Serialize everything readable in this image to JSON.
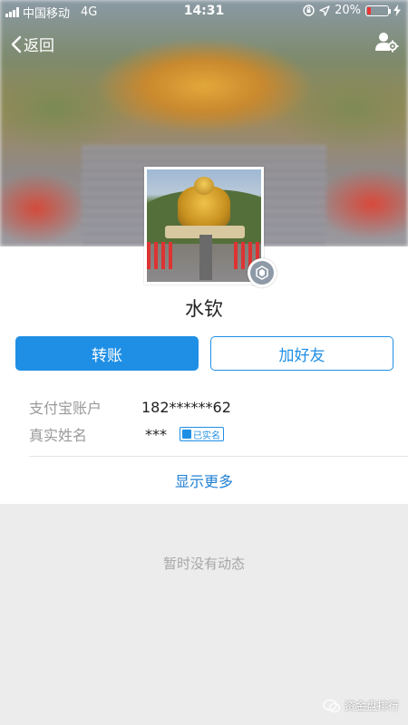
{
  "status_bar": {
    "carrier": "中国移动",
    "network": "4G",
    "time": "14:31",
    "battery_percent": "20%",
    "battery_level": 0.2,
    "icons": [
      "signal-icon",
      "lock-rotation-icon",
      "location-icon",
      "battery-icon",
      "charging-icon"
    ]
  },
  "nav": {
    "back_label": "返回",
    "settings_icon": "user-settings-icon"
  },
  "profile": {
    "name": "水钦",
    "verified_icon": "verified-badge-icon"
  },
  "actions": {
    "transfer_label": "转账",
    "add_friend_label": "加好友"
  },
  "info": {
    "account_label": "支付宝账户",
    "account_value": "182******62",
    "realname_label": "真实姓名",
    "realname_value": "***",
    "realname_badge": "已实名"
  },
  "more_label": "显示更多",
  "empty_state": "暂时没有动态",
  "watermark": "资金盘排行",
  "colors": {
    "accent": "#1f8fe5",
    "link": "#1f7fd4",
    "battery_low": "#e33333"
  }
}
